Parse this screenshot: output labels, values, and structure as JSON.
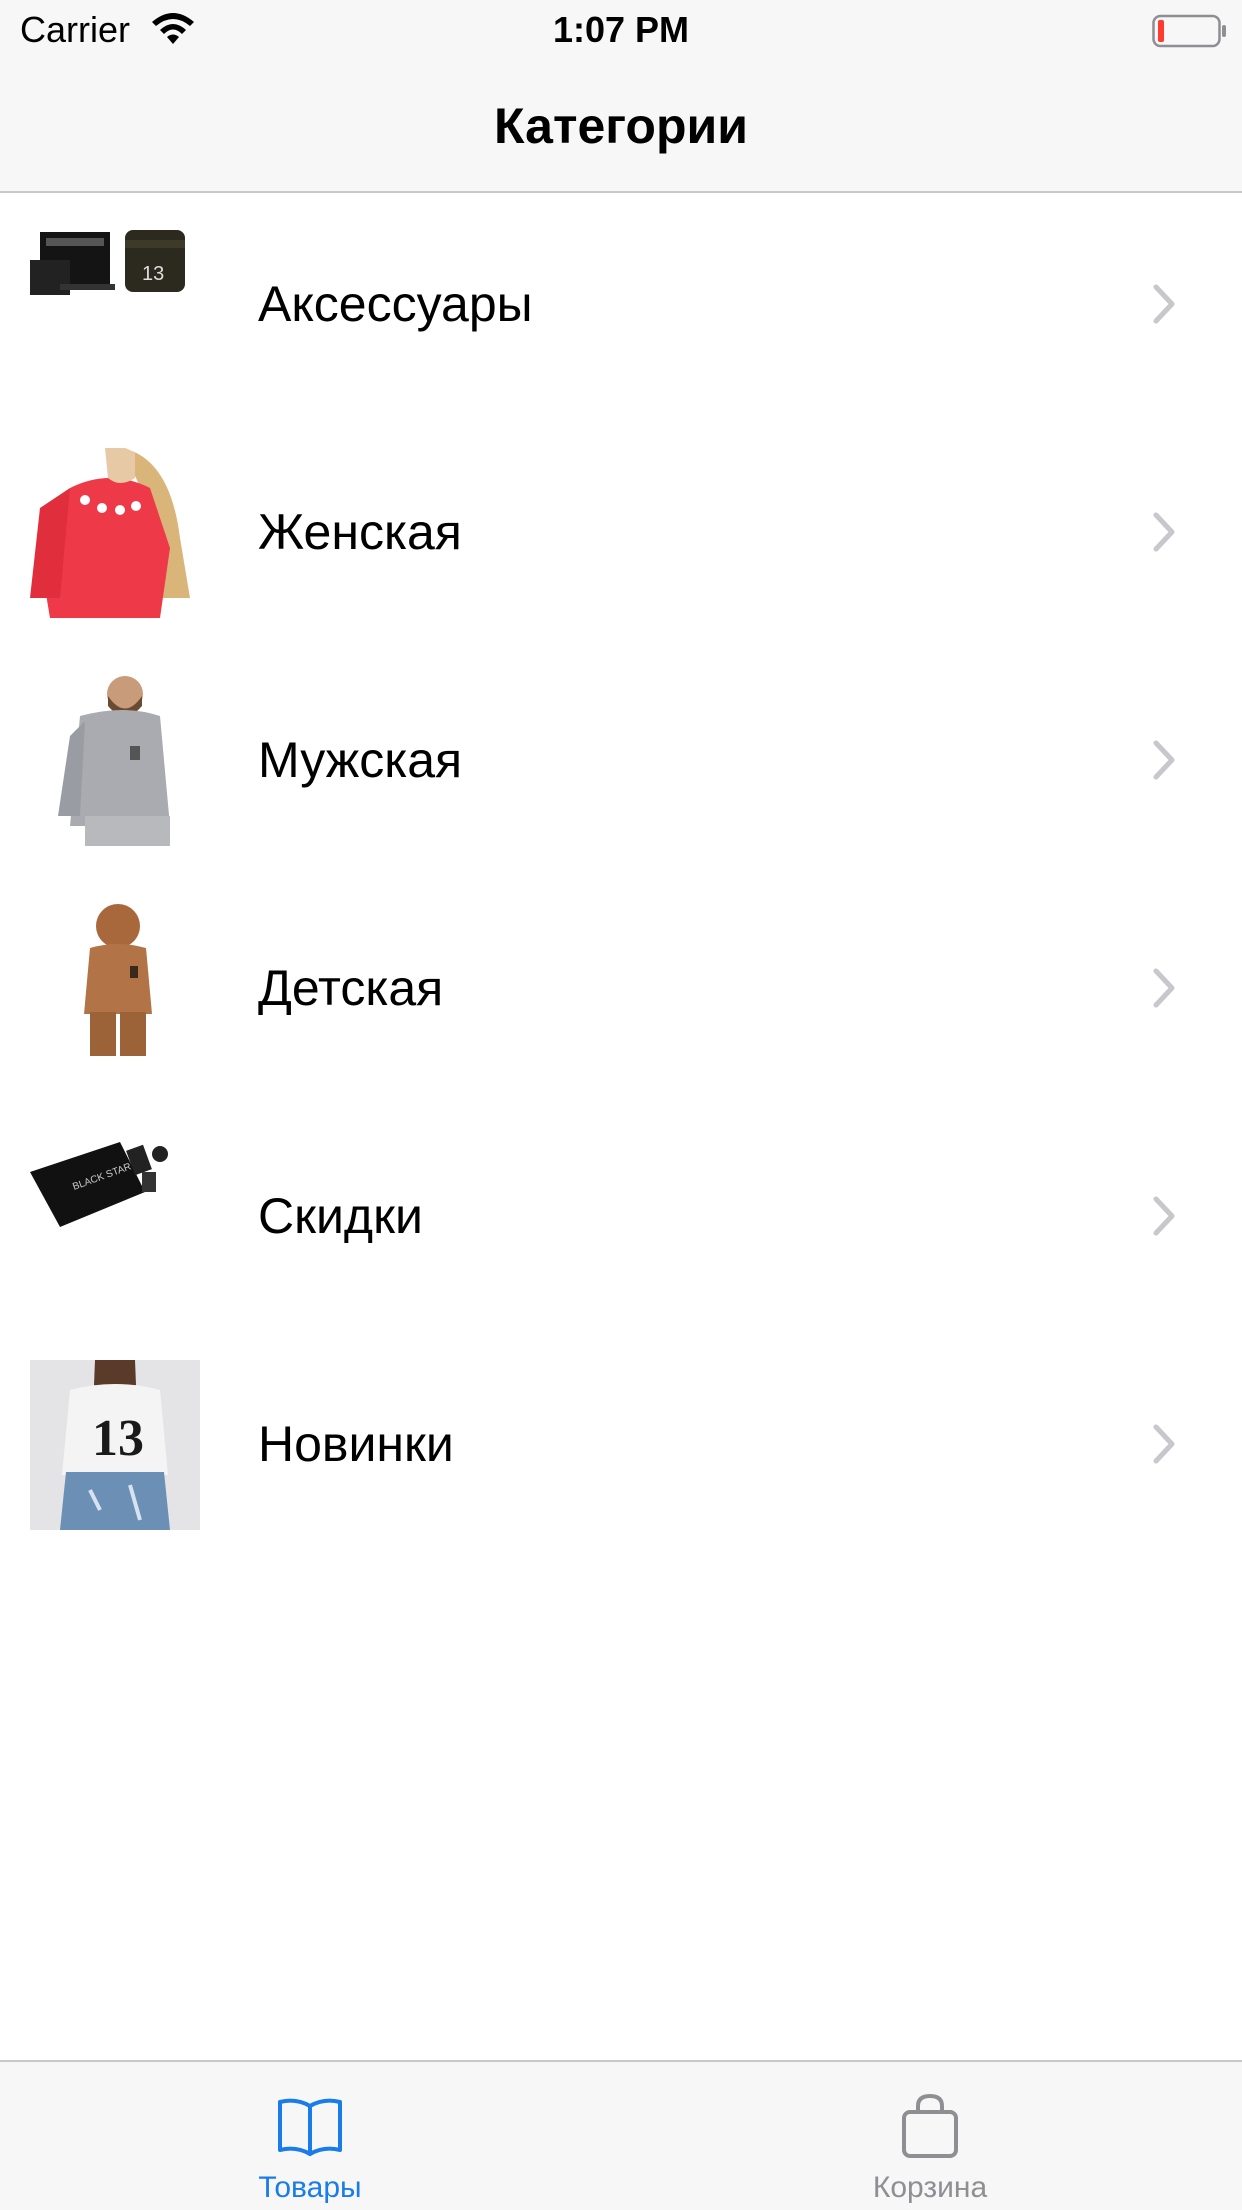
{
  "status_bar": {
    "carrier": "Carrier",
    "time": "1:07 PM"
  },
  "nav": {
    "title": "Категории"
  },
  "categories": [
    {
      "label": "Аксессуары",
      "icon": "accessories-thumbnail"
    },
    {
      "label": "Женская",
      "icon": "womens-thumbnail"
    },
    {
      "label": "Мужская",
      "icon": "mens-thumbnail"
    },
    {
      "label": "Детская",
      "icon": "kids-thumbnail"
    },
    {
      "label": "Скидки",
      "icon": "sale-thumbnail"
    },
    {
      "label": "Новинки",
      "icon": "new-arrivals-thumbnail"
    }
  ],
  "tabs": [
    {
      "label": "Товары",
      "icon": "book-icon",
      "active": true
    },
    {
      "label": "Корзина",
      "icon": "bag-icon",
      "active": false
    }
  ],
  "colors": {
    "accent": "#1a7ce8",
    "inactive": "#8e8e93",
    "chevron": "#c7c7cc",
    "battery_low": "#ff3b30",
    "bar_background": "#f7f7f7"
  }
}
